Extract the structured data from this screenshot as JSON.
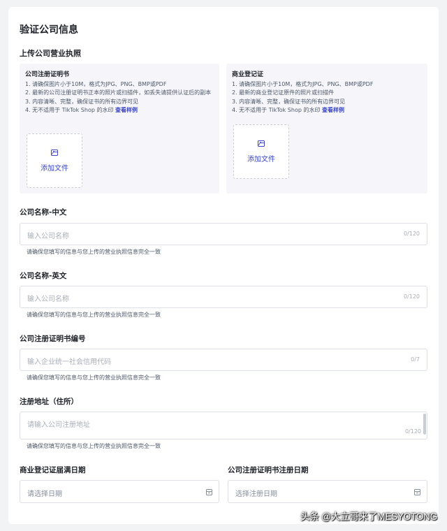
{
  "page_title": "验证公司信息",
  "upload_section": {
    "title": "上传公司营业执照",
    "panels": [
      {
        "title": "公司注册证明书",
        "lines": [
          "1. 请确保图片小于10M，格式为JPG、PNG、BMP或PDF",
          "2. 最新的公司注册证明书正本的照片或扫描件，如丢失请提供认证后的副本",
          "3. 内容清晰、完整，确保证书的所有边界可见"
        ],
        "watermark_line": "4. 无不适用于 TikTok Shop 的水印",
        "example_link": "查看样例",
        "upload_label": "添加文件"
      },
      {
        "title": "商业登记证",
        "lines": [
          "1. 请确保图片小于10M，格式为JPG、PNG、BMP或PDF",
          "2. 最新的商业登记证原件的照片或扫描件",
          "3. 内容清晰、完整，确保证书的所有边界可见"
        ],
        "watermark_line": "4. 无不适用于 TikTok Shop 的水印",
        "example_link": "查看样例",
        "upload_label": "添加文件"
      }
    ]
  },
  "fields": {
    "name_cn": {
      "label": "公司名称-中文",
      "placeholder": "输入公司名称",
      "count": "0/120",
      "hint": "请确保您填写的信息与您上传的营业执照信息完全一致"
    },
    "name_en": {
      "label": "公司名称-英文",
      "placeholder": "输入公司名称",
      "count": "0/120",
      "hint": "请确保您填写的信息与您上传的营业执照信息完全一致"
    },
    "cert_number": {
      "label": "公司注册证明书编号",
      "placeholder": "输入企业统一社会信用代码",
      "count": "0/7",
      "hint": "请确保您填写的信息与您上传的营业执照信息完全一致"
    },
    "address": {
      "label": "注册地址（住所）",
      "placeholder": "请输入公司注册地址",
      "count": "0/120",
      "hint": "请确保您填写的信息与您上传的营业执照信息完全一致"
    },
    "br_expiry": {
      "label": "商业登记证届满日期",
      "placeholder": "请选择日期"
    },
    "cert_reg_date": {
      "label": "公司注册证明书注册日期",
      "placeholder": "选择注册日期"
    }
  },
  "watermark": "头条 @大立哥来了MESYOTONG",
  "colors": {
    "accent": "#3b46c4",
    "panel_bg": "#f5f5fa",
    "border": "#dcdfe6"
  }
}
